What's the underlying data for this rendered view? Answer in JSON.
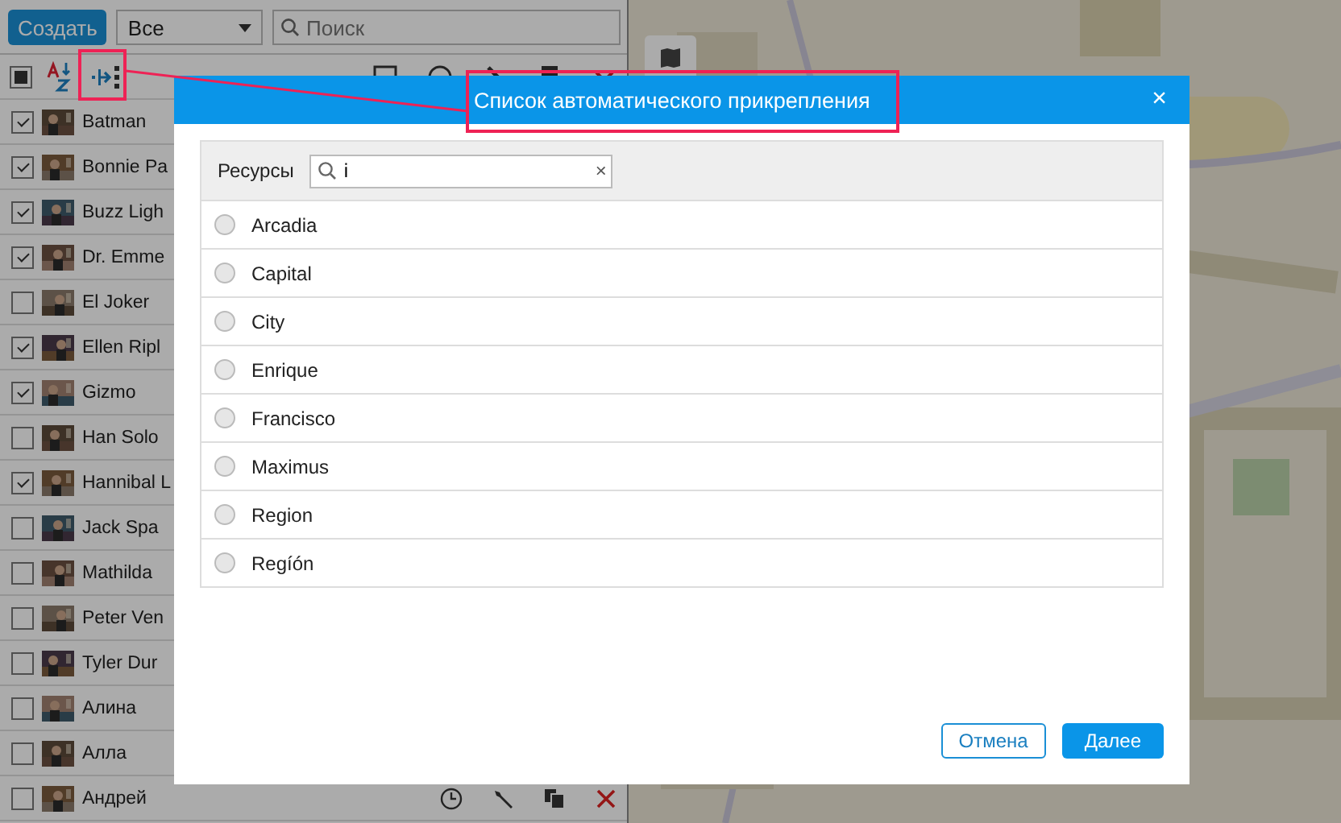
{
  "panel": {
    "create_button": "Создать",
    "filter": {
      "value": "Все"
    },
    "search": {
      "placeholder": "Поиск"
    },
    "select_all": {
      "indeterminate": true
    },
    "units": [
      {
        "name": "Batman",
        "checked": true
      },
      {
        "name": "Bonnie Pa",
        "checked": true
      },
      {
        "name": "Buzz Ligh",
        "checked": true
      },
      {
        "name": "Dr. Emme",
        "checked": true
      },
      {
        "name": "El Joker",
        "checked": false
      },
      {
        "name": "Ellen Ripl",
        "checked": true
      },
      {
        "name": "Gizmo",
        "checked": true
      },
      {
        "name": "Han Solo",
        "checked": false
      },
      {
        "name": "Hannibal L",
        "checked": true
      },
      {
        "name": "Jack Spa",
        "checked": false
      },
      {
        "name": "Mathilda",
        "checked": false
      },
      {
        "name": "Peter Ven",
        "checked": false
      },
      {
        "name": "Tyler Dur",
        "checked": false
      },
      {
        "name": "Алина",
        "checked": false
      },
      {
        "name": "Алла",
        "checked": false
      },
      {
        "name": "Андрей",
        "checked": false
      }
    ]
  },
  "dialog": {
    "title": "Список автоматического прикрепления",
    "close": "×",
    "filter_label": "Ресурсы",
    "search": {
      "value": "i",
      "clear": "×"
    },
    "items": [
      {
        "name": "Arcadia",
        "selected": false
      },
      {
        "name": "Capital",
        "selected": false
      },
      {
        "name": "City",
        "selected": false
      },
      {
        "name": "Enrique",
        "selected": false
      },
      {
        "name": "Francisco",
        "selected": false
      },
      {
        "name": "Maximus",
        "selected": false
      },
      {
        "name": "Region",
        "selected": false
      },
      {
        "name": "Regíón",
        "selected": false
      }
    ],
    "buttons": {
      "cancel": "Отмена",
      "next": "Далее"
    }
  }
}
